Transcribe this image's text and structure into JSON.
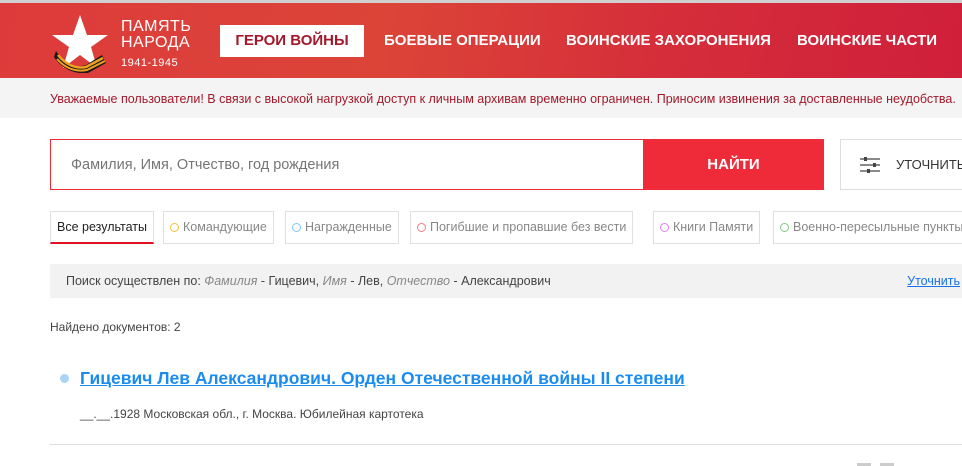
{
  "header": {
    "logo_line1": "ПАМЯТЬ",
    "logo_line2": "НАРОДА",
    "logo_years": "1941-1945",
    "nav": [
      "ГЕРОИ ВОЙНЫ",
      "БОЕВЫЕ ОПЕРАЦИИ",
      "ВОИНСКИЕ ЗАХОРОНЕНИЯ",
      "ВОИНСКИЕ ЧАСТИ"
    ]
  },
  "notice": "Уважаемые пользователи! В связи с высокой нагрузкой доступ к личным архивам временно ограничен. Приносим извинения за доставленные неудобства.",
  "search": {
    "placeholder": "Фамилия, Имя, Отчество, год рождения",
    "find_label": "НАЙТИ",
    "refine_label": "УТОЧНИТЬ"
  },
  "tabs": [
    {
      "label": "Все результаты"
    },
    {
      "label": "Командующие",
      "color": "#f0c040"
    },
    {
      "label": "Награжденные",
      "color": "#7ec8f0"
    },
    {
      "label": "Погибшие и пропавшие без вести",
      "color": "#f08080"
    },
    {
      "label": "Книги Памяти",
      "color": "#e080f0"
    },
    {
      "label": "Военно-пересыльные пункты",
      "color": "#80c880"
    }
  ],
  "info": {
    "prefix": "Поиск осуществлен по:",
    "f1": "Фамилия",
    "v1": "- Гицевич,",
    "f2": "Имя",
    "v2": "- Лев,",
    "f3": "Отчество",
    "v3": "- Александрович",
    "refine_link": "Уточнить"
  },
  "found": "Найдено документов: 2",
  "result": {
    "title": "Гицевич Лев Александрович. Орден Отечественной войны II степени",
    "subtitle": "__.__.1928 Московская обл., г. Москва. Юбилейная картотека"
  }
}
